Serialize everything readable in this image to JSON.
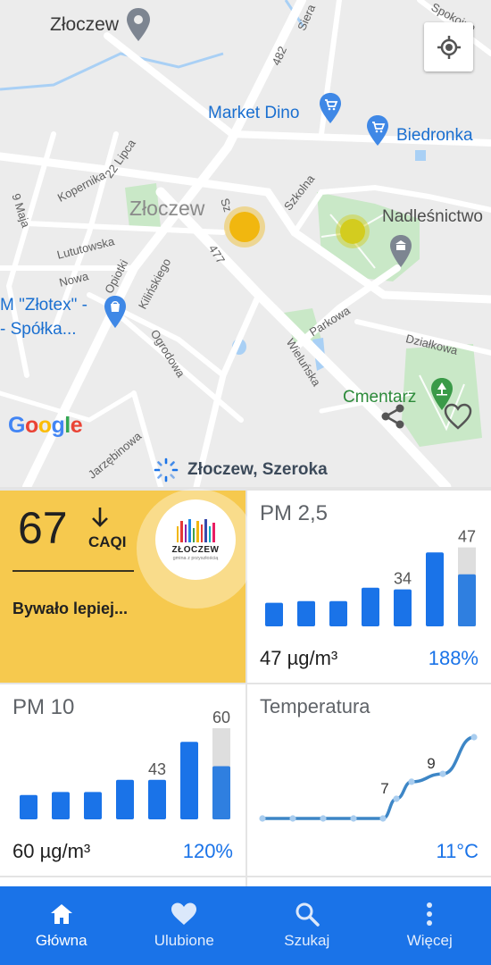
{
  "map": {
    "town_label": "Złoczew",
    "town_label_center": "Złoczew",
    "pois": {
      "market_dino": "Market Dino",
      "biedronka": "Biedronka",
      "nadlesnictwo": "Nadleśnictwo",
      "cmentarz": "Cmentarz",
      "zlotex": "M \"Złotex\" -\n- Spółka..."
    },
    "streets": {
      "sieradzka": "Siera",
      "road_482": "482",
      "spokojna": "Spokojna",
      "lipca": "22 Lipca",
      "kopernika": "Kopernika",
      "maja": "9 Maja",
      "lututowska": "Lututowska",
      "nowa": "Nowa",
      "opiotki": "Opiotki",
      "klinskiego": "Kilińskiego",
      "szeroka": "Sz",
      "road_477": "477",
      "szkolna": "Szkolna",
      "parkowa": "Parkowa",
      "dzialkowa": "Działkowa",
      "wielunska": "Wieluńska",
      "ogrodowa": "Ogrodowa",
      "jarzebinowa": "Jarzębinowa"
    },
    "google_logo": "Google",
    "station_name": "Złoczew, Szeroka",
    "marker_colors": {
      "station_main": "#f1b70f",
      "station_park": "#d3cc1f"
    }
  },
  "aqi_card": {
    "value": "67",
    "unit": "CAQI",
    "trend_icon": "arrow-down-icon",
    "description": "Bywało lepiej...",
    "logo_name": "ZŁOCZEW",
    "logo_tagline": "gmina z przyszłością",
    "background_color": "#f6c94e"
  },
  "pm25_card": {
    "title": "PM 2,5",
    "value": "47 µg/m³",
    "percent": "188%",
    "chart_data": {
      "type": "bar",
      "values": [
        14,
        15,
        15,
        23,
        22,
        44,
        31
      ],
      "highlight_last_background": 47,
      "labels": {
        "4": "34",
        "6": "47"
      },
      "ylim": [
        0,
        50
      ]
    }
  },
  "pm10_card": {
    "title": "PM 10",
    "value": "60 µg/m³",
    "percent": "120%",
    "chart_data": {
      "type": "bar",
      "values": [
        16,
        18,
        18,
        26,
        26,
        51,
        35
      ],
      "highlight_last_background": 60,
      "labels": {
        "4": "43",
        "6": "60"
      },
      "ylim": [
        0,
        60
      ]
    }
  },
  "temp_card": {
    "title": "Temperatura",
    "value": "11°C",
    "chart_data": {
      "type": "line",
      "values": [
        5.8,
        5.8,
        5.8,
        5.8,
        5.8,
        7.3,
        8.6,
        9.2,
        12.0
      ],
      "labels": {
        "5": "7",
        "7": "9"
      }
    }
  },
  "nav": {
    "items": [
      {
        "label": "Główna",
        "icon": "home-icon",
        "active": true
      },
      {
        "label": "Ulubione",
        "icon": "heart-icon",
        "active": false
      },
      {
        "label": "Szukaj",
        "icon": "search-icon",
        "active": false
      },
      {
        "label": "Więcej",
        "icon": "more-vert-icon",
        "active": false
      }
    ]
  },
  "colors": {
    "accent": "#1a73e8",
    "bar": "#1a73e8",
    "bar_current": "#2f7fe0",
    "bar_background": "#dedede",
    "temp_line": "#3d86c6"
  }
}
